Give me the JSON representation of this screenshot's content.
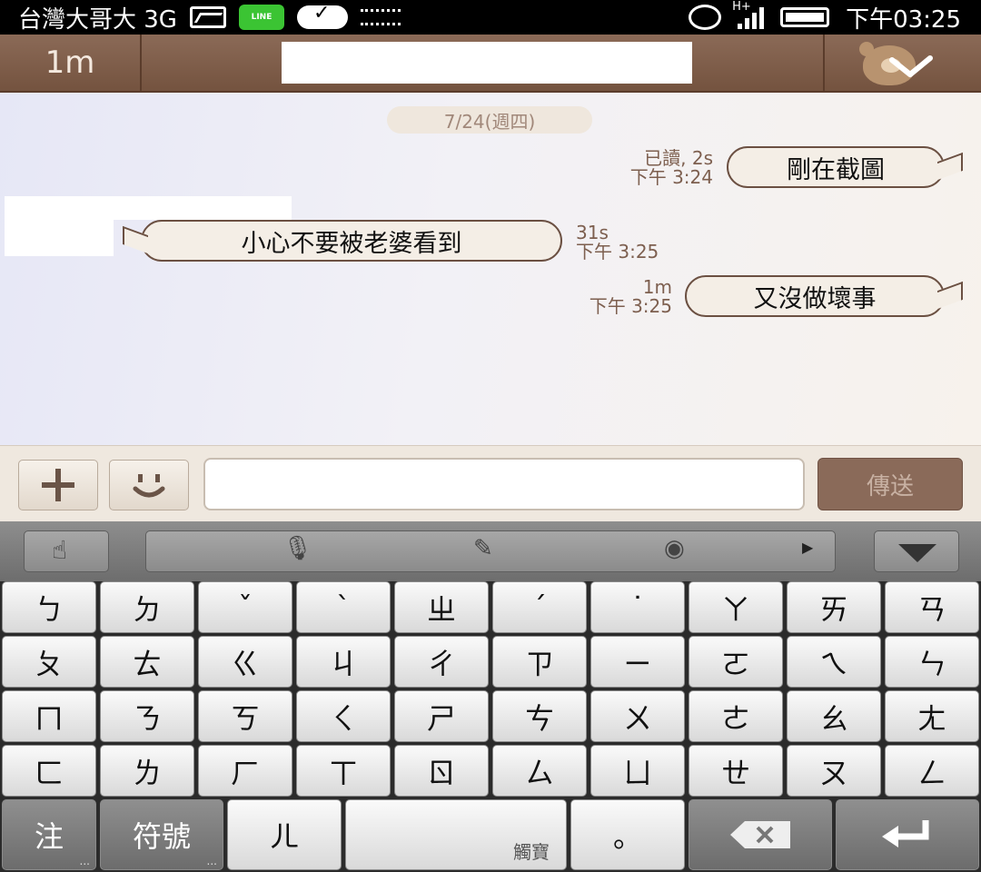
{
  "statusbar": {
    "carrier": "台灣大哥大 3G",
    "line_icon_label": "LINE",
    "network": "H+",
    "time": "下午03:25"
  },
  "header": {
    "back_label": "1m"
  },
  "chat": {
    "date": "7/24(週四)",
    "messages": [
      {
        "side": "right",
        "text": "剛在截圖",
        "status": "已讀, 2s",
        "time": "下午 3:24"
      },
      {
        "side": "left",
        "text": "小心不要被老婆看到",
        "status": "31s",
        "time": "下午 3:25"
      },
      {
        "side": "right",
        "text": "又沒做壞事",
        "status": "1m",
        "time": "下午 3:25"
      }
    ]
  },
  "input": {
    "value": "",
    "send_label": "傳送"
  },
  "keyboard": {
    "rows": [
      [
        "ㄅ",
        "ㄉ",
        "ˇ",
        "ˋ",
        "ㄓ",
        "ˊ",
        "˙",
        "ㄚ",
        "ㄞ",
        "ㄢ"
      ],
      [
        "ㄆ",
        "ㄊ",
        "ㄍ",
        "ㄐ",
        "ㄔ",
        "ㄗ",
        "ㄧ",
        "ㄛ",
        "ㄟ",
        "ㄣ"
      ],
      [
        "ㄇ",
        "ㄋ",
        "ㄎ",
        "ㄑ",
        "ㄕ",
        "ㄘ",
        "ㄨ",
        "ㄜ",
        "ㄠ",
        "ㄤ"
      ],
      [
        "ㄈ",
        "ㄌ",
        "ㄏ",
        "ㄒ",
        "ㄖ",
        "ㄙ",
        "ㄩ",
        "ㄝ",
        "ㄡ",
        "ㄥ"
      ]
    ],
    "bottom": {
      "zhu": "注",
      "symbols": "符號",
      "er": "ㄦ",
      "space_brand": "觸寶",
      "period": "。",
      "more_dots": "..."
    }
  }
}
